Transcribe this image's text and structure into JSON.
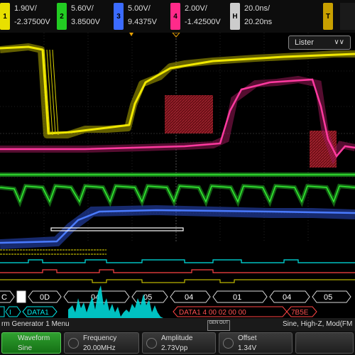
{
  "channels": [
    {
      "num": "1",
      "scale": "1.90V/",
      "offset": "-2.37500V",
      "color": "#e8e000"
    },
    {
      "num": "2",
      "scale": "5.60V/",
      "offset": "3.8500V",
      "color": "#22cc22"
    },
    {
      "num": "3",
      "scale": "5.00V/",
      "offset": "9.4375V",
      "color": "#3b6bff"
    },
    {
      "num": "4",
      "scale": "2.00V/",
      "offset": "-1.42500V",
      "color": "#ff2a8a"
    }
  ],
  "horizontal": {
    "scale": "20.0ns/",
    "position": "20.20ns",
    "icon": "H"
  },
  "trigger": {
    "icon": "T"
  },
  "lister": {
    "label": "Lister"
  },
  "bus": {
    "row1": [
      "C",
      "0D",
      "04",
      "05",
      "04",
      "01",
      "04",
      "05"
    ],
    "row2_left": [
      "I",
      "DATA1"
    ],
    "row2_right": {
      "text": "DATA1  4  00  02  00  00",
      "crc": "7B5E"
    }
  },
  "menu": {
    "title": "rm Generator 1 Menu",
    "status": "Sine, High-Z, Mod(FM",
    "genout": "GEN OUT"
  },
  "softkeys": [
    {
      "label": "Waveform",
      "value": "Sine"
    },
    {
      "label": "Frequency",
      "value": "20.00MHz"
    },
    {
      "label": "Amplitude",
      "value": "2.73Vpp"
    },
    {
      "label": "Offset",
      "value": "1.34V"
    }
  ],
  "colors": {
    "ch1": "#e8e000",
    "ch2": "#22cc22",
    "ch3": "#3b6bff",
    "ch4": "#ff2a8a",
    "bus": "#00e6e6",
    "trigger": "#e8a000",
    "zone": "#b01820"
  }
}
